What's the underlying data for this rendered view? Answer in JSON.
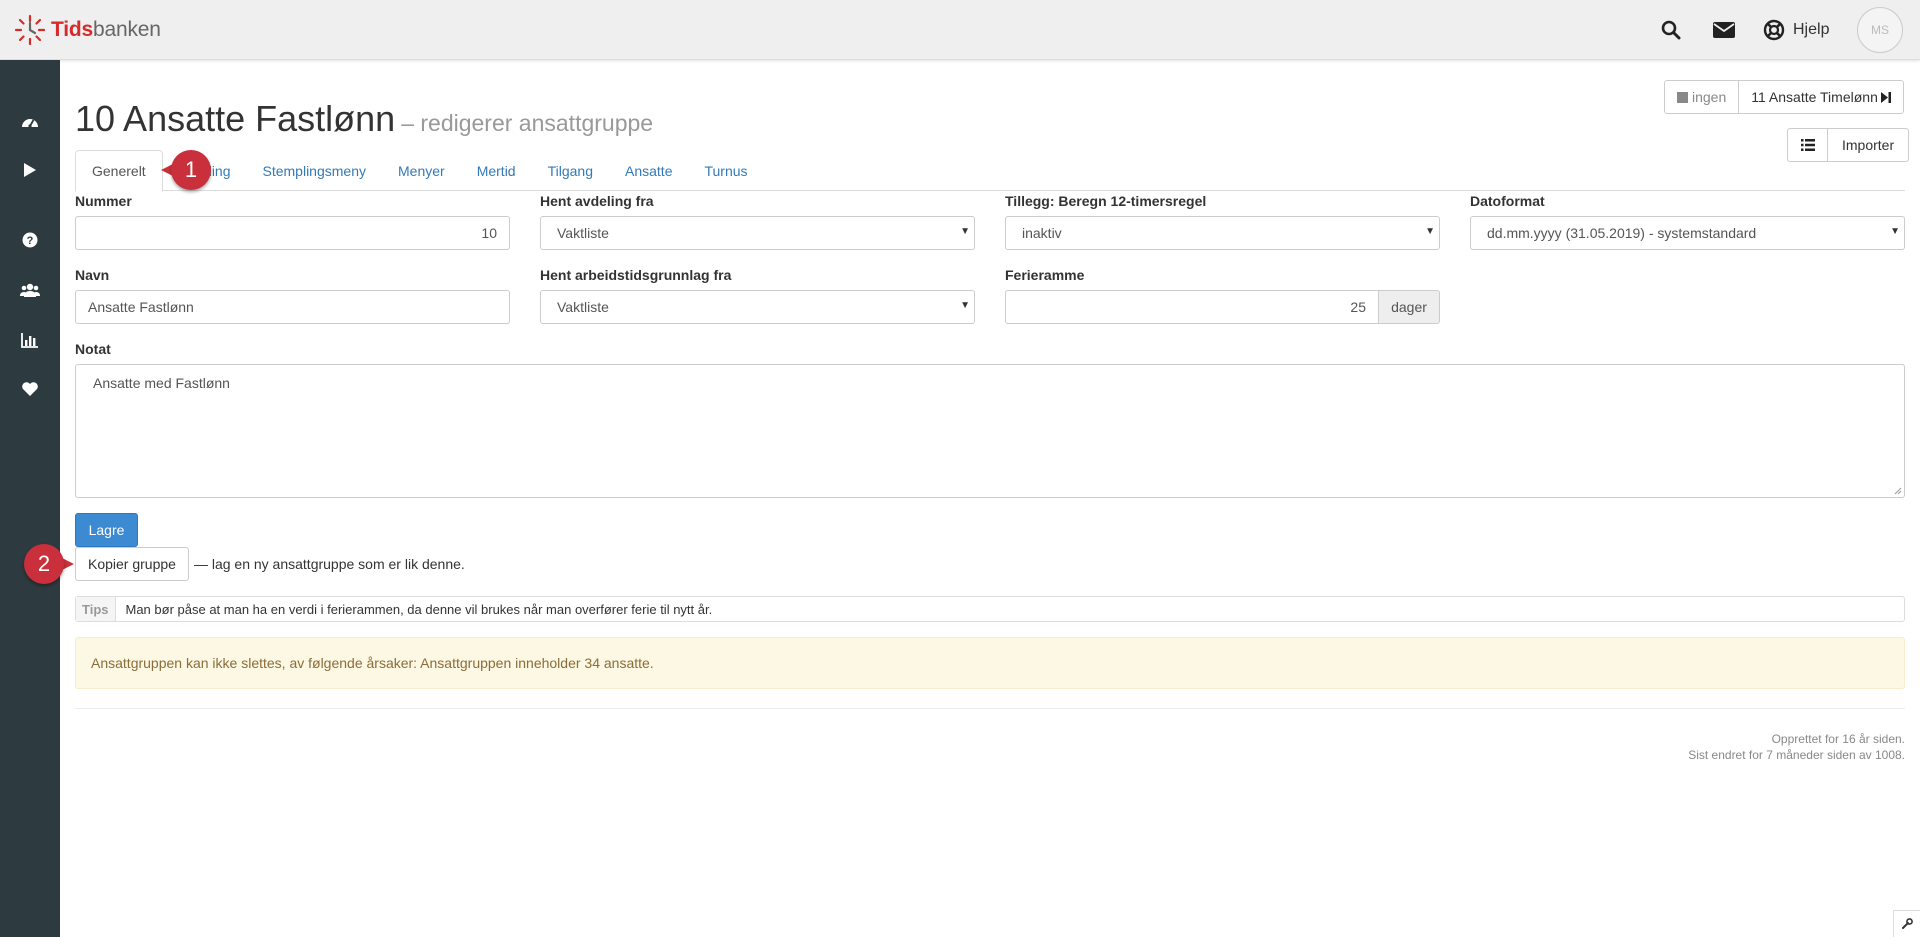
{
  "header": {
    "logo_part1": "Tids",
    "logo_part2": "banken",
    "help_label": "Hjelp",
    "avatar_initials": "MS",
    "icons": [
      "search-icon",
      "envelope-icon",
      "lifebuoy-icon"
    ]
  },
  "sidebar": {
    "icons": [
      "dashboard-icon",
      "play-icon",
      "question-icon",
      "users-icon",
      "bar-chart-icon",
      "heart-icon"
    ]
  },
  "page": {
    "title": "10 Ansatte Fastlønn",
    "subtitle": "– redigerer ansattgruppe"
  },
  "nav": {
    "prev_label": "ingen",
    "next_label": "11 Ansatte Timelønn",
    "list_icon": "list-icon",
    "import_label": "Importer"
  },
  "tabs": [
    {
      "label": "Generelt",
      "active": true
    },
    {
      "label": "ling",
      "active": false
    },
    {
      "label": "Stemplingsmeny",
      "active": false
    },
    {
      "label": "Menyer",
      "active": false
    },
    {
      "label": "Mertid",
      "active": false
    },
    {
      "label": "Tilgang",
      "active": false
    },
    {
      "label": "Ansatte",
      "active": false
    },
    {
      "label": "Turnus",
      "active": false
    }
  ],
  "form": {
    "nummer_label": "Nummer",
    "nummer_value": "10",
    "navn_label": "Navn",
    "navn_value": "Ansatte Fastlønn",
    "avdeling_label": "Hent avdeling fra",
    "avdeling_value": "Vaktliste",
    "arbeidstid_label": "Hent arbeidstidsgrunnlag fra",
    "arbeidstid_value": "Vaktliste",
    "tillegg_label": "Tillegg: Beregn 12-timersregel",
    "tillegg_value": "inaktiv",
    "ferieramme_label": "Ferieramme",
    "ferieramme_value": "25",
    "ferieramme_unit": "dager",
    "datoformat_label": "Datoformat",
    "datoformat_value": "dd.mm.yyyy (31.05.2019) - systemstandard",
    "notat_label": "Notat",
    "notat_value": "Ansatte med Fastlønn"
  },
  "actions": {
    "save_label": "Lagre",
    "copy_label": "Kopier gruppe",
    "copy_desc": "— lag en ny ansattgruppe som er lik denne."
  },
  "tips": {
    "label": "Tips",
    "text": "Man bør påse at man ha en verdi i ferierammen, da denne vil brukes når man overfører ferie til nytt år."
  },
  "warning": {
    "text": "Ansattgruppen kan ikke slettes, av følgende årsaker: Ansattgruppen inneholder 34 ansatte."
  },
  "meta": {
    "created": "Opprettet for 16 år siden.",
    "modified": "Sist endret for 7 måneder siden av 1008."
  },
  "markers": [
    "1",
    "2"
  ],
  "colors": {
    "primary": "#3c8ad1",
    "sidebar": "#2d3a40",
    "marker": "#c9303b",
    "link": "#337ab7",
    "warning_bg": "#fcf8e3",
    "brand_red": "#d52b2b"
  }
}
